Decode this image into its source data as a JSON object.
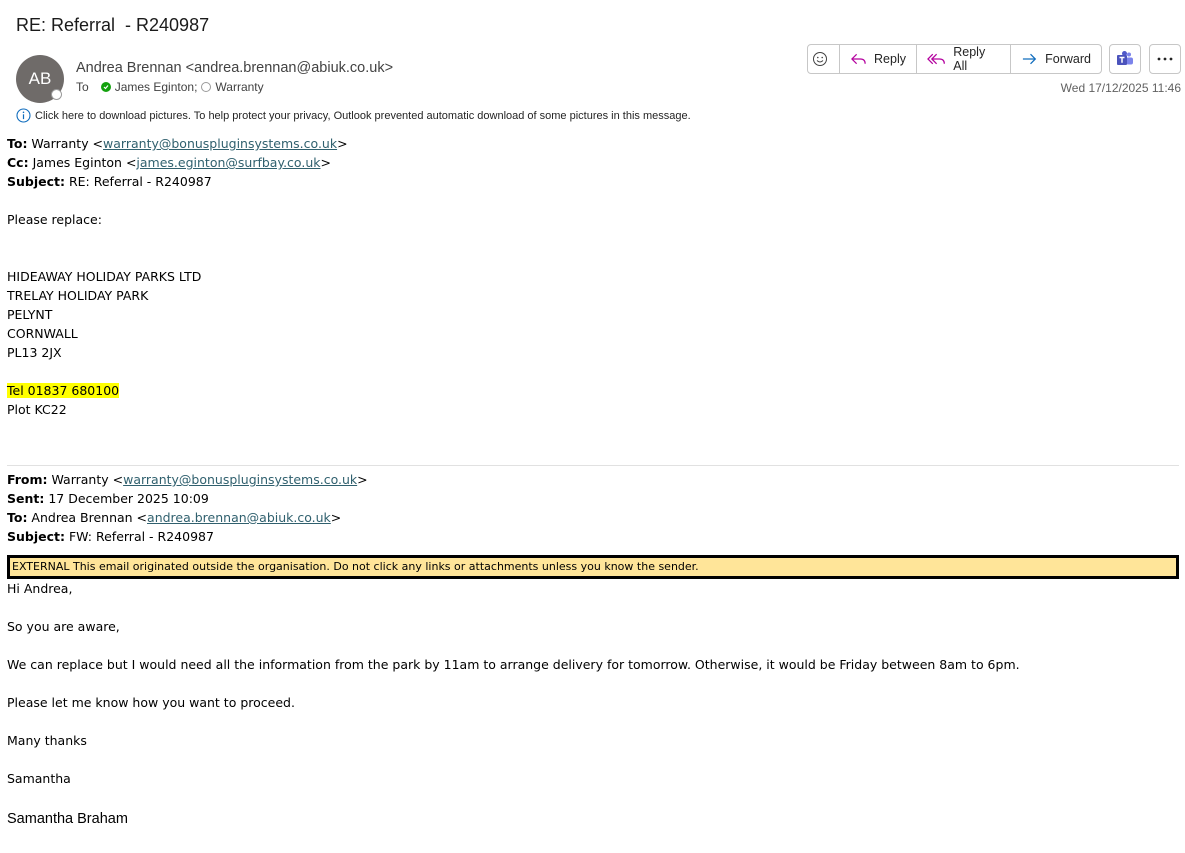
{
  "message": {
    "subject": "RE: Referral  - R240987",
    "avatar_initials": "AB",
    "sender": "Andrea Brennan <andrea.brennan@abiuk.co.uk>",
    "to_label": "To",
    "recipients": [
      "James Eginton;",
      "Warranty"
    ],
    "date": "Wed 17/12/2025 11:46",
    "info_bar": "Click here to download pictures. To help protect your privacy, Outlook prevented automatic download of some pictures in this message."
  },
  "toolbar": {
    "reply": "Reply",
    "reply_all": "Reply All",
    "forward": "Forward"
  },
  "headers": {
    "to_label": "To:",
    "to_name": " Warranty <",
    "to_email": "warranty@bonuspluginsystems.co.uk",
    "cc_label": "Cc:",
    "cc_name": " James Eginton <",
    "cc_email": "james.eginton@surfbay.co.uk",
    "subject_label": "Subject:",
    "subject_value": " RE: Referral - R240987",
    "close_bracket": ">"
  },
  "reply_body": {
    "intro": "Please replace:",
    "address": [
      "HIDEAWAY HOLIDAY PARKS LTD",
      "TRELAY HOLIDAY PARK",
      "PELYNT",
      "CORNWALL",
      "PL13 2JX"
    ],
    "tel": "Tel 01837 680100",
    "plot": "Plot KC22"
  },
  "forwarded": {
    "from_label": "From:",
    "from_name": " Warranty <",
    "from_email": "warranty@bonuspluginsystems.co.uk",
    "sent_label": "Sent:",
    "sent_value": " 17 December 2025 10:09",
    "to_label": "To:",
    "to_name": " Andrea Brennan <",
    "to_email": "andrea.brennan@abiuk.co.uk",
    "subject_label": "Subject:",
    "subject_value": " FW: Referral - R240987",
    "close_bracket": ">",
    "external_notice": "EXTERNAL This email originated outside the organisation. Do not click any links or attachments unless you know the sender.",
    "greeting": "Hi Andrea,",
    "line1": "So you are aware,",
    "line2": "We can replace but I would need all the information from the park by 11am to arrange delivery for tomorrow. Otherwise, it would be Friday between 8am to 6pm.",
    "line3": "Please let me know how you want to proceed.",
    "thanks": "Many thanks",
    "name": "Samantha",
    "signature": "Samantha Braham"
  },
  "colors": {
    "highlight": "#ffff00",
    "external_bg": "#ffe599",
    "link": "#30606e",
    "avatar": "#6f6b69"
  }
}
